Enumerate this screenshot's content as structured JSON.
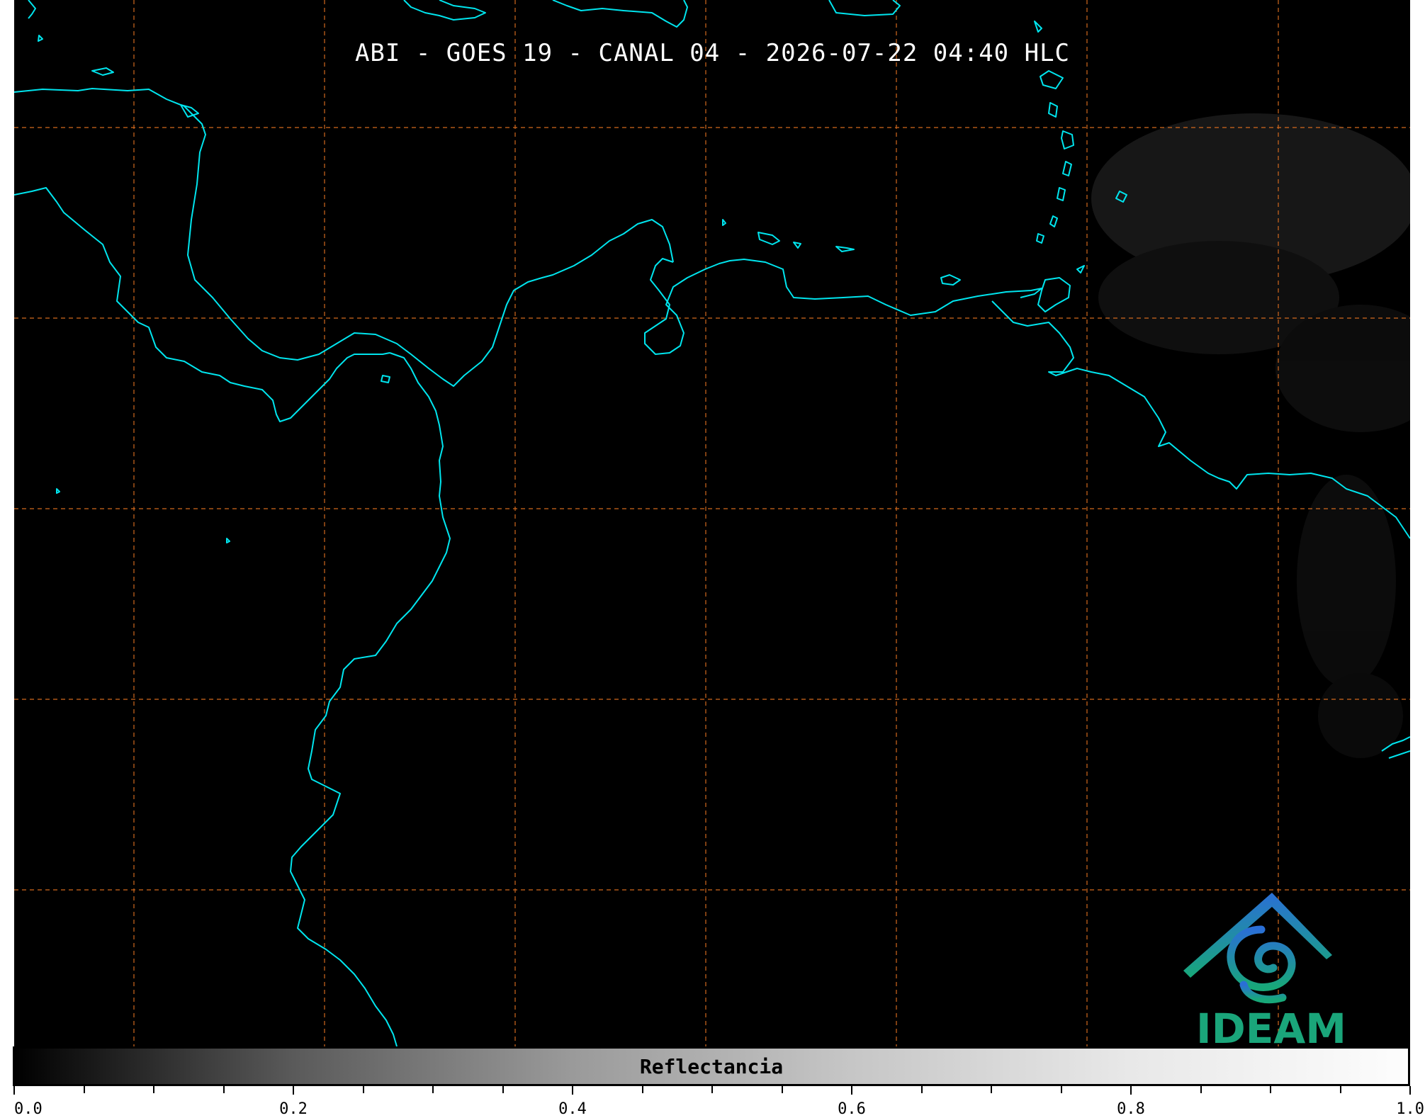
{
  "title": "ABI - GOES 19 - CANAL 04 - 2026-07-22 04:40 HLC",
  "colorbar": {
    "label": "Reflectancia",
    "range": [
      0.0,
      1.0
    ],
    "tick_labels": [
      "0.0",
      "0.2",
      "0.4",
      "0.6",
      "0.8",
      "1.0"
    ],
    "minor_ticks": 21,
    "colormap": "grayscale"
  },
  "logo": {
    "text": "IDEAM",
    "color": "#1aa57a"
  },
  "colors": {
    "background": "#000000",
    "coastline": "#00e5ee",
    "gridline": "#d2691e"
  },
  "gridlines": {
    "style": "dashed",
    "vertical_count": 7,
    "horizontal_count": 4
  }
}
